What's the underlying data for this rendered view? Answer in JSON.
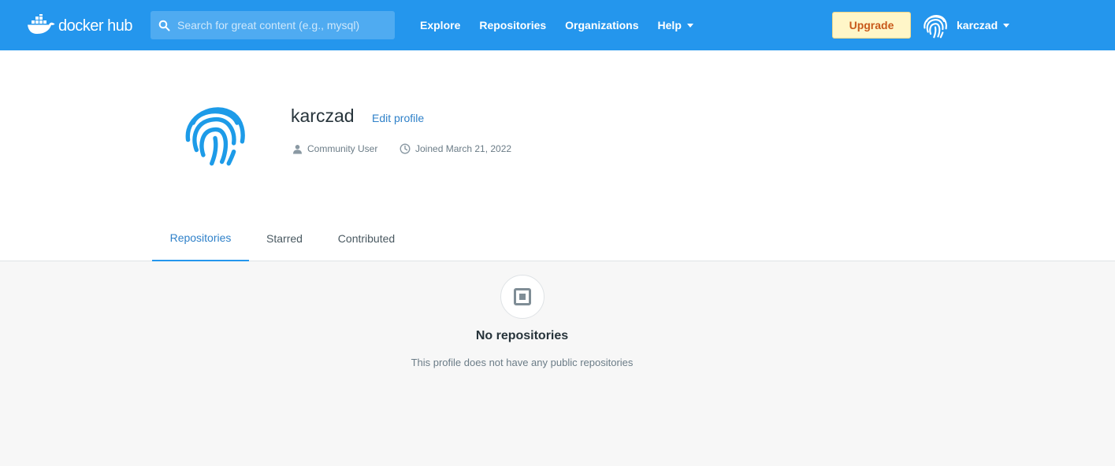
{
  "header": {
    "logo_text": "docker hub",
    "search_placeholder": "Search for great content (e.g., mysql)",
    "nav": [
      {
        "label": "Explore"
      },
      {
        "label": "Repositories"
      },
      {
        "label": "Organizations"
      },
      {
        "label": "Help"
      }
    ],
    "upgrade_label": "Upgrade",
    "user_name": "karczad"
  },
  "profile": {
    "username": "karczad",
    "edit_label": "Edit profile",
    "role": "Community User",
    "joined": "Joined March 21, 2022"
  },
  "tabs": [
    {
      "label": "Repositories",
      "active": true
    },
    {
      "label": "Starred",
      "active": false
    },
    {
      "label": "Contributed",
      "active": false
    }
  ],
  "empty_state": {
    "title": "No repositories",
    "description": "This profile does not have any public repositories"
  },
  "colors": {
    "brand_blue": "#2496ed",
    "link_blue": "#2f81c9",
    "upgrade_bg": "#fff6c8",
    "upgrade_text": "#c8591a"
  },
  "icons": {
    "logo": "docker-whale-icon",
    "search": "search-icon",
    "avatar": "fingerprint-icon",
    "role": "user-icon",
    "joined": "clock-icon",
    "empty": "repository-box-icon"
  }
}
